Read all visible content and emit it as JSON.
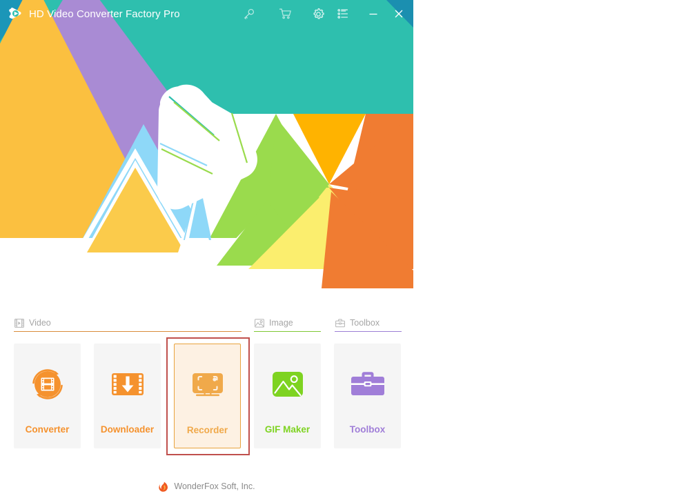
{
  "window": {
    "title": "HD Video Converter Factory Pro",
    "logo_icon": "play-logo-icon"
  },
  "titlebar": {
    "buttons": [
      {
        "name": "key-icon",
        "label": "Register"
      },
      {
        "name": "cart-icon",
        "label": "Buy"
      },
      {
        "name": "gear-icon",
        "label": "Settings"
      },
      {
        "name": "list-icon",
        "label": "Menu"
      },
      {
        "name": "minimize-icon",
        "label": "Minimize"
      },
      {
        "name": "close-icon",
        "label": "Close"
      }
    ]
  },
  "categories": [
    {
      "label": "Video",
      "icon": "film-icon",
      "accent": "#d98c3a"
    },
    {
      "label": "Image",
      "icon": "picture-icon",
      "accent": "#7ec832"
    },
    {
      "label": "Toolbox",
      "icon": "briefcase-icon",
      "accent": "#9b7fd4"
    }
  ],
  "cards": [
    {
      "label": "Converter",
      "icon": "converter-icon",
      "color": "#f5922e",
      "selected": false
    },
    {
      "label": "Downloader",
      "icon": "downloader-icon",
      "color": "#f5922e",
      "selected": false
    },
    {
      "label": "Recorder",
      "icon": "recorder-icon",
      "color": "#f0a94a",
      "selected": true
    },
    {
      "label": "GIF Maker",
      "icon": "gif-maker-icon",
      "color": "#7ed321",
      "selected": false
    },
    {
      "label": "Toolbox",
      "icon": "toolbox-icon",
      "color": "#a07ed8",
      "selected": false
    }
  ],
  "footer": {
    "text": "WonderFox Soft, Inc.",
    "logo_icon": "wonderfox-flame-icon"
  },
  "colors": {
    "teal": "#2ebfae",
    "teal_dark": "#1b96b8",
    "purple": "#a98bd4",
    "orange_yellow": "#fbc040",
    "gold": "#fbcb4b",
    "amber": "#ffb300",
    "sky": "#8ed8f8",
    "green": "#9adb4d",
    "pale_yellow": "#fbee6e",
    "deep_orange": "#f07c32",
    "selected_border": "#e8a33d",
    "annotation_red": "#c0504d"
  }
}
